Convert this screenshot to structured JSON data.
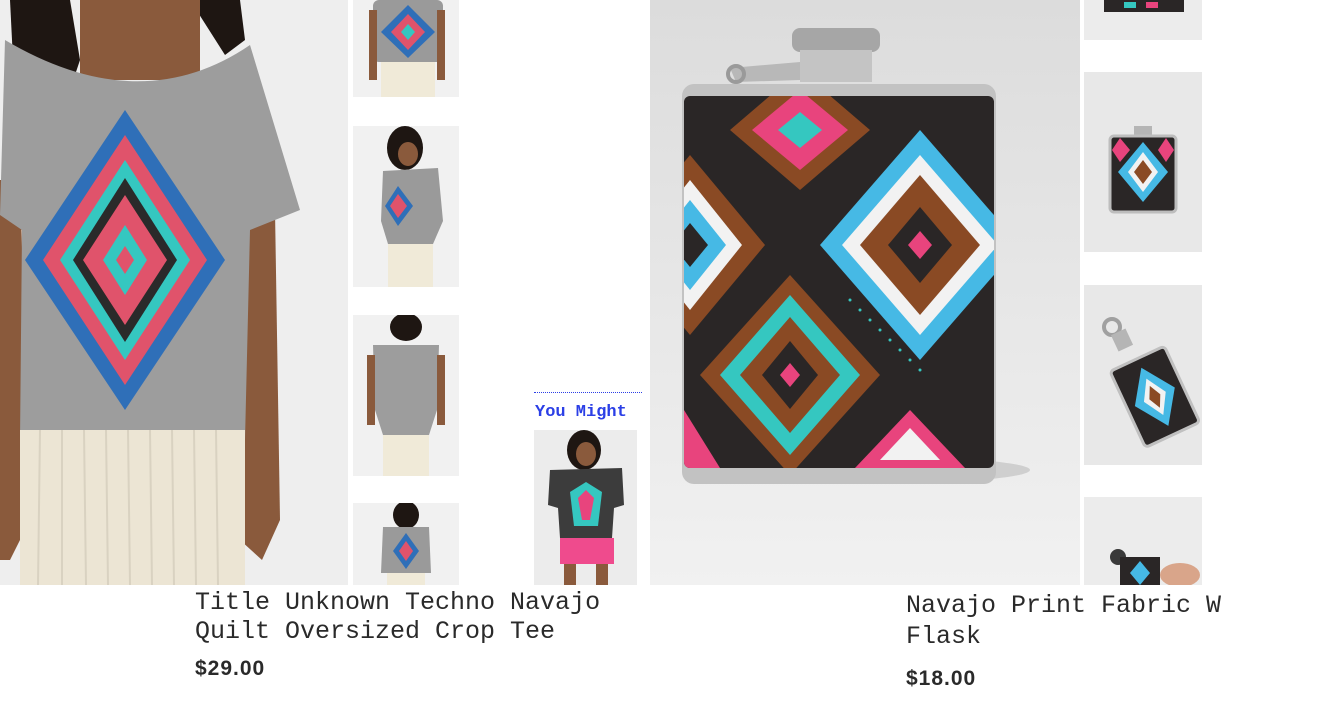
{
  "products": [
    {
      "title_line1": "Title Unknown Techno Navajo",
      "title_line2": "Quilt Oversized Crop Tee",
      "price": "$29.00"
    },
    {
      "title_line1": "Navajo Print Fabric W",
      "title_line2": "Flask",
      "price": "$18.00"
    }
  ],
  "recommendations": {
    "heading": "You Might"
  },
  "colors": {
    "pattern_red": "#e0536b",
    "pattern_blue": "#2f6fb8",
    "pattern_teal": "#35c7c0",
    "pattern_brown": "#8a4a24",
    "pattern_pink": "#e8447d",
    "link_blue": "#2b3fe6"
  }
}
